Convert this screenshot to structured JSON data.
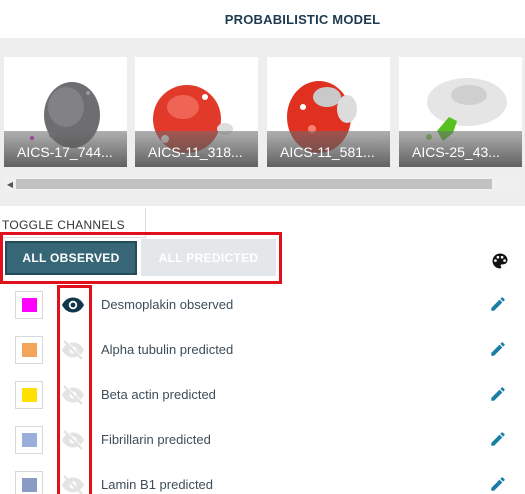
{
  "header": {
    "title": "PROBABILISTIC MODEL"
  },
  "gallery": {
    "thumbnails": [
      {
        "label": "AICS-17_744..."
      },
      {
        "label": "AICS-11_318..."
      },
      {
        "label": "AICS-11_581..."
      },
      {
        "label": "AICS-25_43..."
      }
    ]
  },
  "toggle": {
    "title": "TOGGLE CHANNELS",
    "all_observed_label": "ALL OBSERVED",
    "all_predicted_label": "ALL PREDICTED"
  },
  "channels": [
    {
      "name": "Desmoplakin observed",
      "color": "#ff00ff",
      "visible": true
    },
    {
      "name": "Alpha tubulin predicted",
      "color": "#f4a55a",
      "visible": false
    },
    {
      "name": "Beta actin predicted",
      "color": "#ffe000",
      "visible": false
    },
    {
      "name": "Fibrillarin predicted",
      "color": "#9aaedc",
      "visible": false
    },
    {
      "name": "Lamin B1 predicted",
      "color": "#8a9cc4",
      "visible": false
    }
  ],
  "colors": {
    "accent": "#376777",
    "highlight": "#e0111d",
    "icon": "#1a7ea5"
  }
}
